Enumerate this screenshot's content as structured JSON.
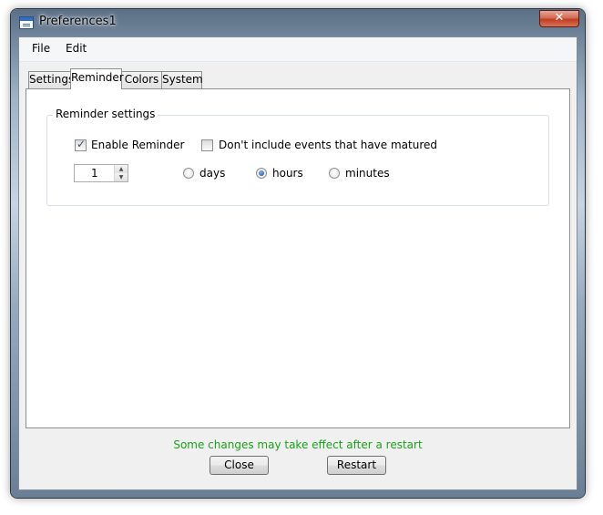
{
  "window": {
    "title": "Preferences1",
    "close_symbol": "✕"
  },
  "menu": [
    "File",
    "Edit"
  ],
  "tabs": [
    {
      "label": "Settings",
      "active": false
    },
    {
      "label": "Reminder",
      "active": true
    },
    {
      "label": "Colors",
      "active": false
    },
    {
      "label": "System",
      "active": false
    }
  ],
  "reminder": {
    "group_title": "Reminder settings",
    "enable_reminder": {
      "label": "Enable Reminder",
      "checked": true
    },
    "exclude_matured": {
      "label": "Don't include events that have matured",
      "checked": false
    },
    "interval_value": "1",
    "units": [
      {
        "label": "days",
        "checked": false
      },
      {
        "label": "hours",
        "checked": true
      },
      {
        "label": "minutes",
        "checked": false
      }
    ]
  },
  "footer": {
    "status": "Some changes may take effect after a restart",
    "close_label": "Close",
    "restart_label": "Restart"
  },
  "icons": {
    "spin_up": "▲",
    "spin_down": "▼"
  },
  "colors": {
    "status_text": "#1aa31a",
    "close_button": "#c23d22"
  }
}
